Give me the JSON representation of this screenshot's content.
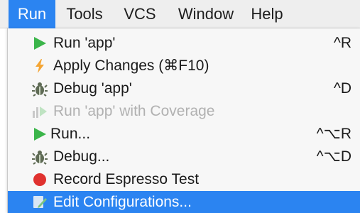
{
  "menubar": {
    "items": [
      {
        "label": "Run",
        "active": true
      },
      {
        "label": "Tools"
      },
      {
        "label": "VCS"
      },
      {
        "label": "Window"
      },
      {
        "label": "Help"
      }
    ]
  },
  "run_menu": {
    "items": [
      {
        "label": "Run 'app'",
        "shortcut": "^R",
        "icon": "run-triangle-icon",
        "enabled": true
      },
      {
        "label": "Apply Changes (⌘F10)",
        "shortcut": "",
        "icon": "lightning-bolt-icon",
        "enabled": true
      },
      {
        "label": "Debug 'app'",
        "shortcut": "^D",
        "icon": "debug-bug-icon",
        "enabled": true
      },
      {
        "label": "Run 'app' with Coverage",
        "shortcut": "",
        "icon": "coverage-icon",
        "enabled": false
      },
      {
        "label": "Run...",
        "shortcut": "^⌥R",
        "icon": "run-triangle-icon",
        "enabled": true
      },
      {
        "label": "Debug...",
        "shortcut": "^⌥D",
        "icon": "debug-bug-icon",
        "enabled": true
      },
      {
        "label": "Record Espresso Test",
        "shortcut": "",
        "icon": "record-dot-icon",
        "enabled": true
      },
      {
        "label": "Edit Configurations...",
        "shortcut": "",
        "icon": "edit-configurations-icon",
        "enabled": true,
        "highlighted": true
      }
    ]
  },
  "colors": {
    "highlight": "#2b84f1",
    "run_green": "#3bb54a",
    "apply_orange": "#f4a534",
    "record_red": "#e0322f",
    "disabled_text": "#b1b1b1"
  }
}
